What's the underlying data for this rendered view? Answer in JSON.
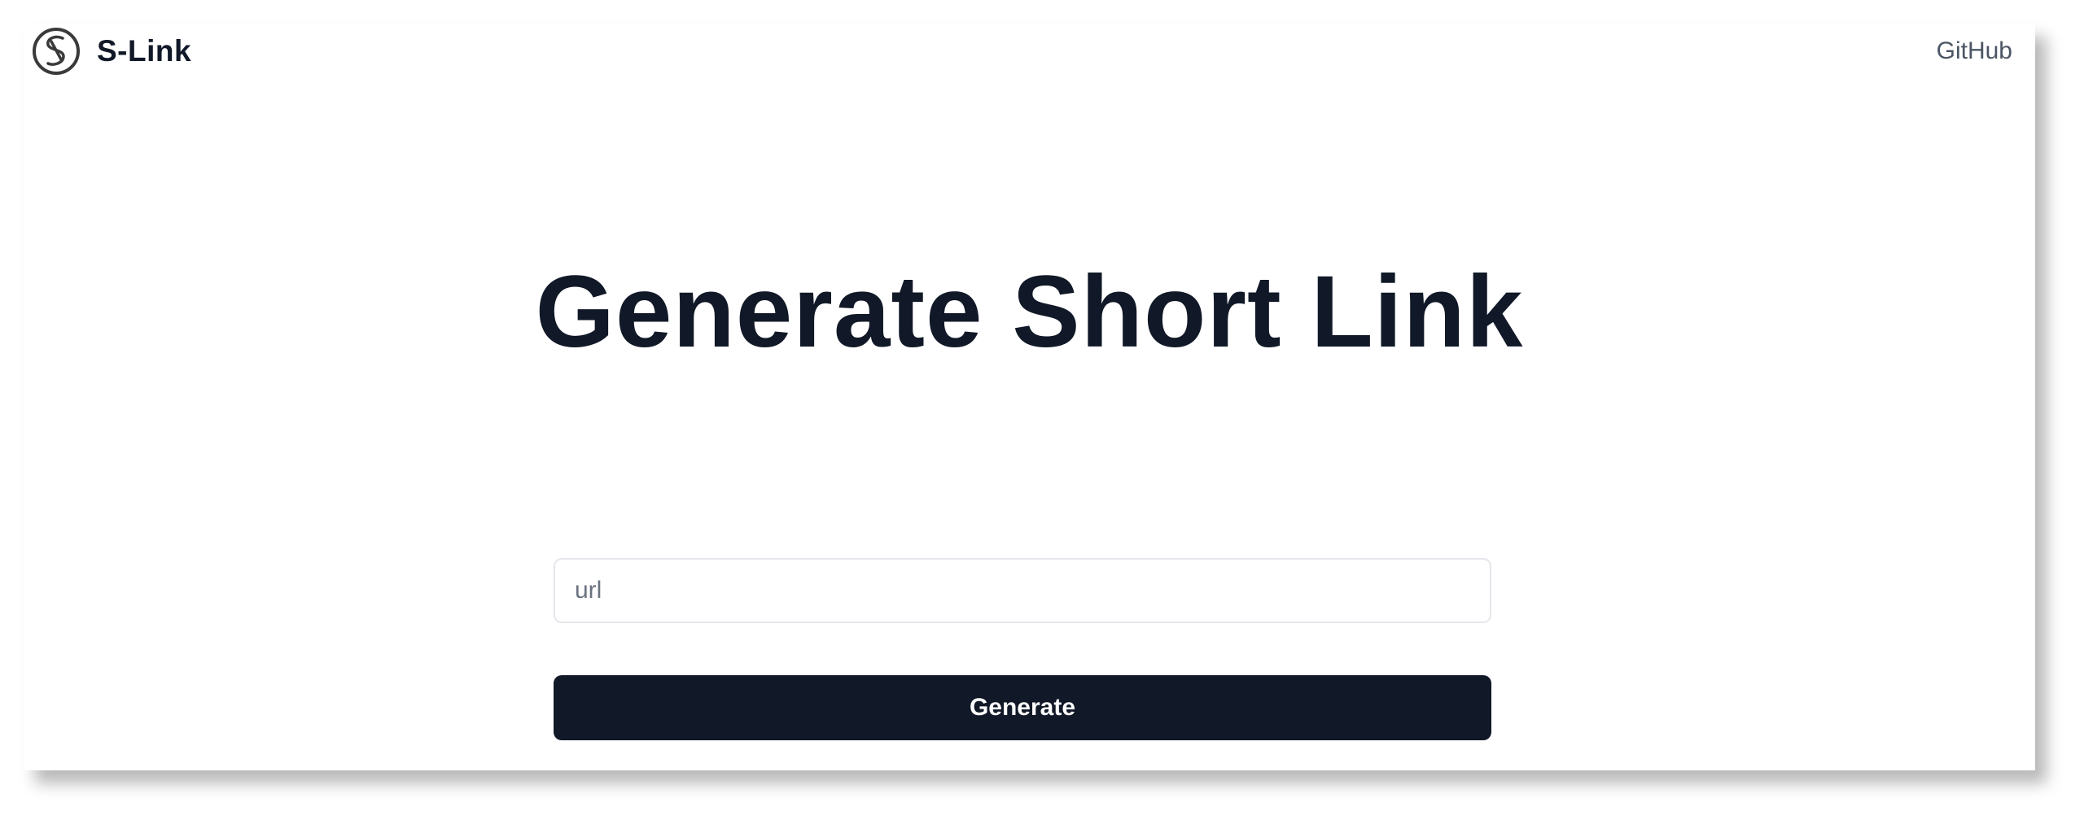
{
  "header": {
    "brand_name": "S-Link",
    "logo_icon": "s-circle-logo-icon",
    "github_link": "GitHub"
  },
  "main": {
    "title": "Generate Short Link",
    "url_input": {
      "value": "",
      "placeholder": "url"
    },
    "generate_button": "Generate"
  },
  "colors": {
    "text_primary": "#111827",
    "text_muted": "#4b5563",
    "button_bg": "#111827",
    "button_text": "#ffffff",
    "input_border": "#e5e7eb"
  }
}
